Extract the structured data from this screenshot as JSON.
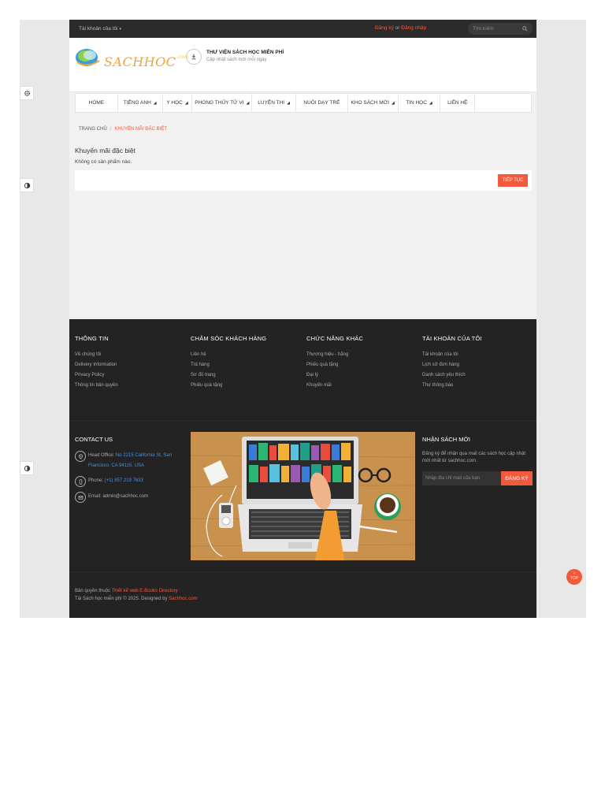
{
  "topbar": {
    "account_label": "Tài khoản của tôi",
    "register": "Đăng ký",
    "or": "or",
    "login": "Đăng nhập",
    "search_placeholder": "Tìm kiếm"
  },
  "header": {
    "logo_text": "SACHHOC",
    "logo_suffix": ".com",
    "title": "THƯ VIỆN SÁCH HỌC MIỄN PHÍ",
    "subtitle": "Cập nhật sách mới mỗi ngày"
  },
  "nav": {
    "items": [
      {
        "label": "HOME",
        "caret": false
      },
      {
        "label": "TIẾNG ANH",
        "caret": true
      },
      {
        "label": "Y HỌC",
        "caret": true
      },
      {
        "label": "PHONG THỦY TỬ VI",
        "caret": true
      },
      {
        "label": "LUYỆN THI",
        "caret": true
      },
      {
        "label": "NUÔI DẠY TRẺ",
        "caret": false
      },
      {
        "label": "KHO SÁCH MỚI",
        "caret": true
      },
      {
        "label": "TIN HỌC",
        "caret": true
      },
      {
        "label": "LIÊN HỆ",
        "caret": false
      },
      {
        "label": "",
        "caret": false
      }
    ]
  },
  "breadcrumb": {
    "home": "TRANG CHỦ",
    "separator": "/",
    "current": "KHUYẾN MÃI ĐẶC BIỆT"
  },
  "main": {
    "title": "Khuyến mãi đặc biệt",
    "empty_text": "Không có sản phẩm nào.",
    "continue_label": "TIẾP TỤC"
  },
  "footer": {
    "columns": [
      {
        "title": "THÔNG TIN",
        "items": [
          "Về chúng tôi",
          "Delivery Information",
          "Privacy Policy",
          "Thông tin bản quyền"
        ]
      },
      {
        "title": "CHĂM SÓC KHÁCH HÀNG",
        "items": [
          "Liên hệ",
          "Trả hàng",
          "Sơ đồ trang",
          "Phiếu quà tặng"
        ]
      },
      {
        "title": "CHỨC NĂNG KHÁC",
        "items": [
          "Thương hiệu - hãng",
          "Phiếu quà tặng",
          "Đại lý",
          "Khuyến mãi"
        ]
      },
      {
        "title": "TÀI KHOẢN CỦA TÔI",
        "items": [
          "Tài khoản của tôi",
          "Lịch sử đơn hàng",
          "Danh sách yêu thích",
          "Thư thông báo"
        ]
      }
    ],
    "contact": {
      "title": "CONTACT US",
      "office_label": "Head Office:",
      "office_value": "No 2215 California St, San Francisco, CA 94115, USA",
      "phone_label": "Phone:",
      "phone_value": "(+1) 857 219 7633",
      "email_label": "Email:",
      "email_value": "admin@sachhoc.com"
    },
    "newsletter": {
      "title": "NHẬN SÁCH MỚI",
      "desc": "Đăng ký để nhận qua mail các sách học cập nhật mới nhất từ sachhoc.com.",
      "placeholder": "Nhập địa chỉ mail của bạn",
      "button": "ĐĂNG KÝ"
    },
    "copyright": {
      "line1_prefix": "Bản quyền thuộc",
      "line1_link": "Thiết kế web E-Books Directory",
      "line2_prefix": "Tải Sách học miễn phí © 2025. Designed by",
      "line2_link": "Sachhoc.com"
    }
  },
  "top_button": {
    "label": "TOP"
  },
  "colors": {
    "accent": "#f15a3a",
    "dark": "#232323",
    "link": "#4a90d9"
  }
}
